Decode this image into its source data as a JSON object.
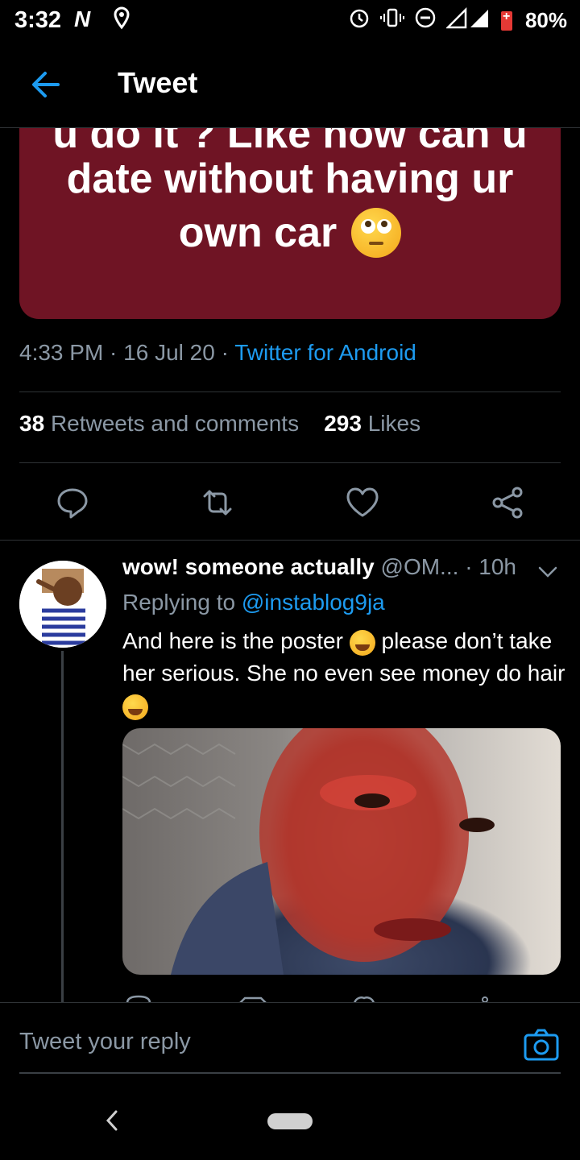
{
  "status_bar": {
    "time": "3:32",
    "app_letter": "N",
    "battery_percent": "80%"
  },
  "header": {
    "title": "Tweet"
  },
  "tweet": {
    "image_text_line1": "u do it ? Like how can u",
    "image_text_line2": "date without having ur",
    "image_text_line3": "own car",
    "card_color": "#6f1424",
    "time": "4:33 PM",
    "date": "16 Jul 20",
    "source": "Twitter for Android",
    "retweets_count": "38",
    "retweets_label": "Retweets and comments",
    "likes_count": "293",
    "likes_label": "Likes"
  },
  "reply": {
    "name": "wow! someone actually",
    "handle": "@OM...",
    "time": "· 10h",
    "replying_prefix": "Replying to",
    "replying_handle": "@instablog9ja",
    "text_part1": "And here is the poster",
    "text_part2": "please don’t take her serious. She no even see money do hair"
  },
  "composer": {
    "placeholder": "Tweet your reply"
  },
  "colors": {
    "accent": "#1d9bf0",
    "muted": "#8b98a5",
    "background": "#000000"
  }
}
